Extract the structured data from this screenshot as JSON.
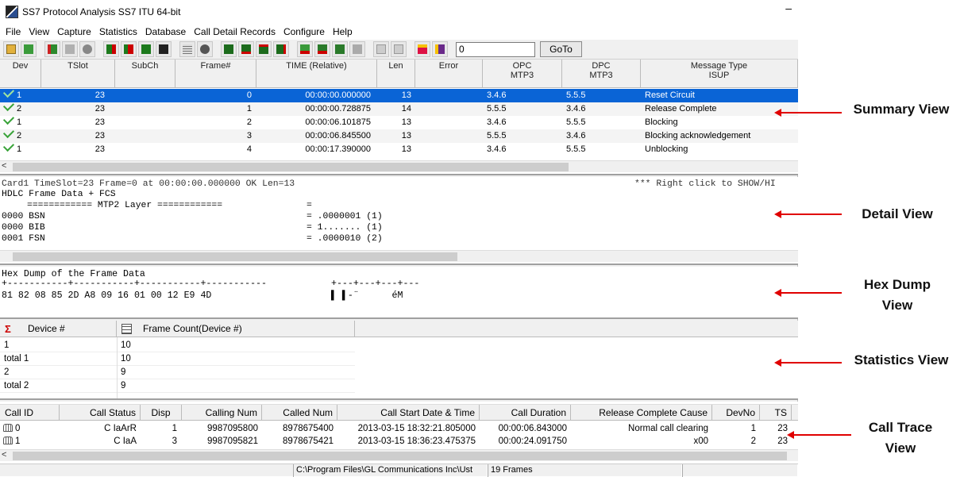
{
  "window": {
    "title": "SS7 Protocol Analysis SS7 ITU 64-bit",
    "minimize_glyph": "–"
  },
  "menu": [
    "File",
    "View",
    "Capture",
    "Statistics",
    "Database",
    "Call Detail Records",
    "Configure",
    "Help"
  ],
  "toolbar": {
    "goto_value": "0",
    "goto_label": "GoTo"
  },
  "summary": {
    "columns": [
      "Dev",
      "TSlot",
      "SubCh",
      "Frame#",
      "TIME (Relative)",
      "Len",
      "Error",
      "OPC\nMTP3",
      "DPC\nMTP3",
      "Message Type\nISUP"
    ],
    "rows": [
      {
        "dev": "1",
        "tslot": "23",
        "frame": "0",
        "time": "00:00:00.000000",
        "len": "13",
        "opc": "3.4.6",
        "dpc": "5.5.5",
        "msg": "Reset Circuit",
        "selected": true
      },
      {
        "dev": "2",
        "tslot": "23",
        "frame": "1",
        "time": "00:00:00.728875",
        "len": "14",
        "opc": "5.5.5",
        "dpc": "3.4.6",
        "msg": "Release Complete"
      },
      {
        "dev": "1",
        "tslot": "23",
        "frame": "2",
        "time": "00:00:06.101875",
        "len": "13",
        "opc": "3.4.6",
        "dpc": "5.5.5",
        "msg": "Blocking"
      },
      {
        "dev": "2",
        "tslot": "23",
        "frame": "3",
        "time": "00:00:06.845500",
        "len": "13",
        "opc": "5.5.5",
        "dpc": "3.4.6",
        "msg": "Blocking acknowledgement"
      },
      {
        "dev": "1",
        "tslot": "23",
        "frame": "4",
        "time": "00:00:17.390000",
        "len": "13",
        "opc": "3.4.6",
        "dpc": "5.5.5",
        "msg": "Unblocking"
      }
    ]
  },
  "detail": {
    "header": "Card1 TimeSlot=23 Frame=0 at 00:00:00.000000 OK Len=13",
    "hint": "*** Right click to SHOW/HI",
    "title": "HDLC Frame Data + FCS",
    "layer": "============ MTP2 Layer ============",
    "layer_eq": "=",
    "fields": [
      {
        "label": "0000 BSN",
        "value": "= .0000001 (1)"
      },
      {
        "label": "0000 BIB",
        "value": "= 1....... (1)"
      },
      {
        "label": "0001 FSN",
        "value": "= .0000010 (2)"
      }
    ]
  },
  "hexdump": {
    "title": "Hex Dump of the Frame Data",
    "ruler": "+-----------+-----------+-----------+-----------",
    "ruler2": "+---+---+---+---",
    "bytes": "81 82 08 85 2D A8 09 16 01 00 12 E9 4D",
    "ascii": "▌ ▌-¨      éM"
  },
  "statistics": {
    "columns": [
      "Device #",
      "Frame Count(Device #)"
    ],
    "rows": [
      {
        "device": "1",
        "count": "10"
      },
      {
        "device": "total 1",
        "count": "10"
      },
      {
        "device": "2",
        "count": "9"
      },
      {
        "device": "total 2",
        "count": "9"
      }
    ]
  },
  "calltrace": {
    "columns": [
      "Call ID",
      "Call Status",
      "Disp",
      "Calling Num",
      "Called Num",
      "Call Start Date & Time",
      "Call Duration",
      "Release Complete Cause",
      "DevNo",
      "TS"
    ],
    "rows": [
      {
        "id": "0",
        "status": "C IaArR",
        "disp": "1",
        "calling": "9987095800",
        "called": "8978675400",
        "start": "2013-03-15 18:32:21.805000",
        "duration": "00:00:06.843000",
        "cause": "Normal call clearing",
        "devno": "1",
        "ts": "23"
      },
      {
        "id": "1",
        "status": "C IaA",
        "disp": "3",
        "calling": "9987095821",
        "called": "8978675421",
        "start": "2013-03-15 18:36:23.475375",
        "duration": "00:00:24.091750",
        "cause": "x00",
        "devno": "2",
        "ts": "23"
      }
    ]
  },
  "statusbar": {
    "path": "C:\\Program Files\\GL Communications Inc\\Ust",
    "frames": "19 Frames"
  },
  "annotations": {
    "summary": "Summary View",
    "detail": "Detail View",
    "hexdump_1": "Hex Dump",
    "hexdump_2": "View",
    "statistics": "Statistics View",
    "calltrace_1": "Call Trace",
    "calltrace_2": "View"
  },
  "colors": {
    "selection": "#0a64d6",
    "annotation_arrow": "#e00000"
  }
}
